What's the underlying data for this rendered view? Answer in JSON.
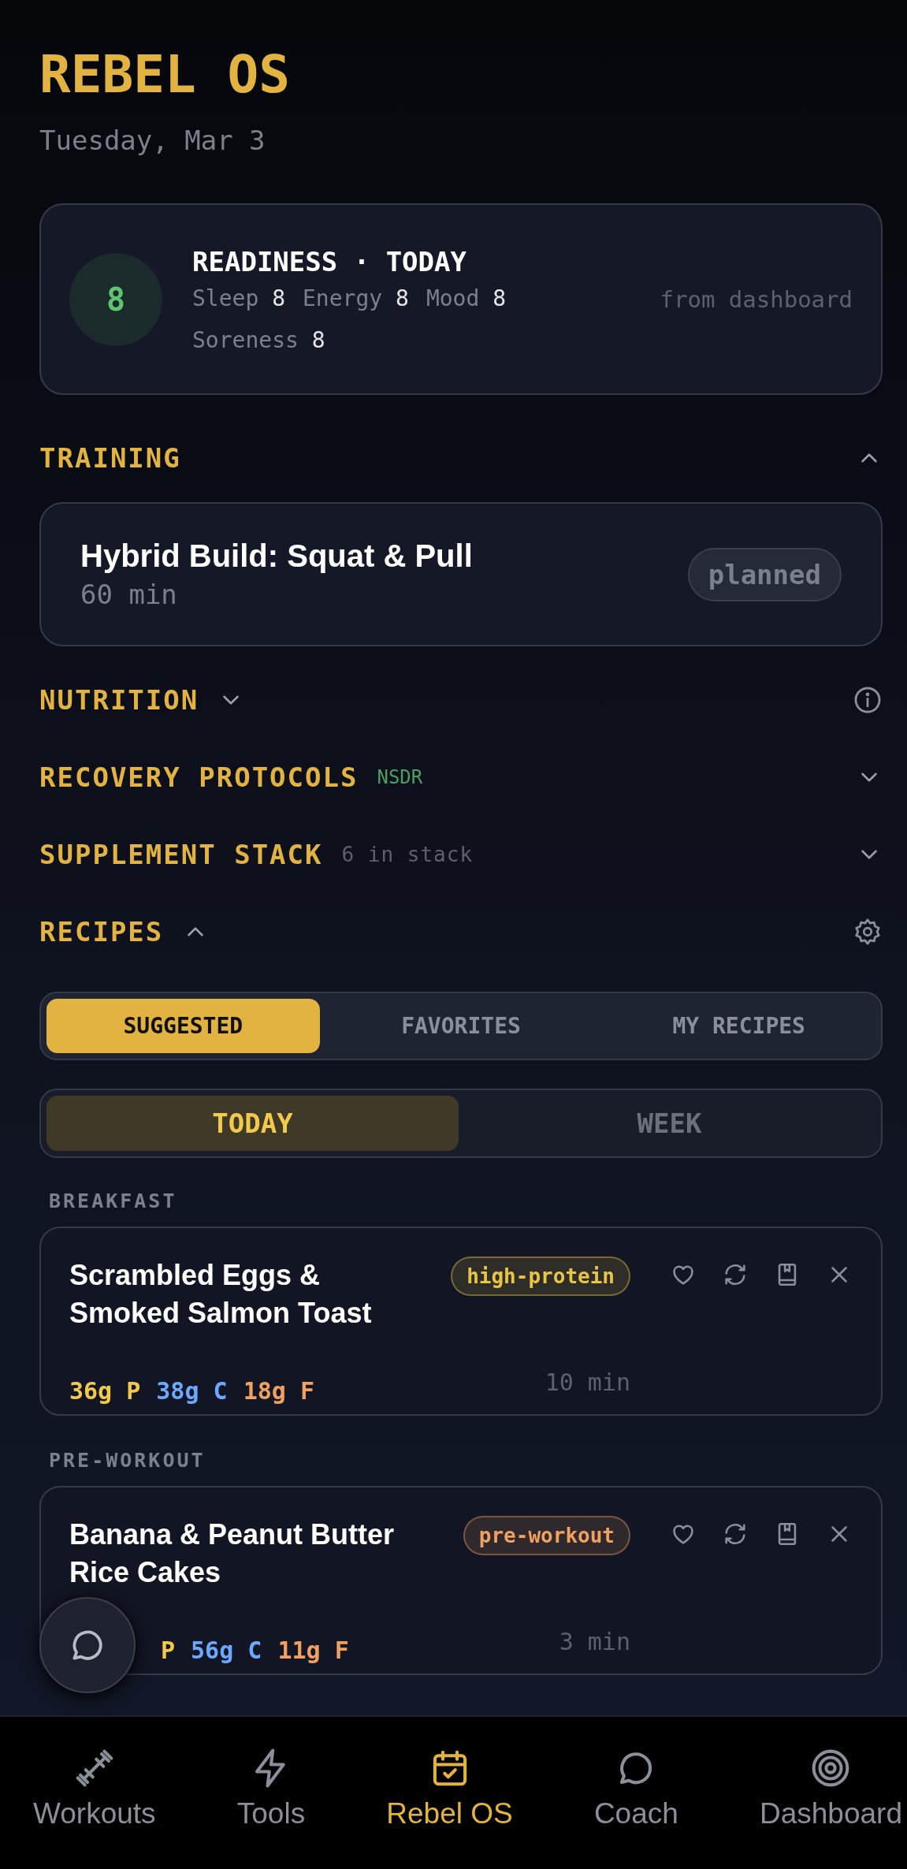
{
  "app_title": "REBEL OS",
  "date": "Tuesday, Mar 3",
  "readiness": {
    "score": "8",
    "title": "READINESS · TODAY",
    "metrics": [
      {
        "label": "Sleep",
        "value": "8"
      },
      {
        "label": "Energy",
        "value": "8"
      },
      {
        "label": "Mood",
        "value": "8"
      },
      {
        "label": "Soreness",
        "value": "8"
      }
    ],
    "source": "from dashboard"
  },
  "sections": [
    {
      "kind": "end-chevron",
      "title": "TRAINING",
      "expanded": true
    },
    {
      "kind": "inline-chevron",
      "title": "NUTRITION",
      "expanded": false,
      "info_button": true
    },
    {
      "kind": "end-chevron",
      "title": "RECOVERY PROTOCOLS",
      "expanded": false,
      "tag": "NSDR"
    },
    {
      "kind": "end-chevron",
      "title": "SUPPLEMENT STACK",
      "expanded": false,
      "note": "6 in stack"
    },
    {
      "kind": "inline-chevron",
      "title": "RECIPES",
      "expanded": true,
      "settings_button": true
    }
  ],
  "training": {
    "workout": "Hybrid Build: Squat & Pull",
    "duration": "60 min",
    "status": "planned"
  },
  "recipe_tabs": [
    {
      "label": "SUGGESTED",
      "selected": true
    },
    {
      "label": "FAVORITES",
      "selected": false
    },
    {
      "label": "MY RECIPES",
      "selected": false
    }
  ],
  "periods": [
    {
      "label": "TODAY",
      "selected": true
    },
    {
      "label": "WEEK",
      "selected": false
    }
  ],
  "meals": [
    {
      "slot": "BREAKFAST",
      "title": "Scrambled Eggs & Smoked Salmon Toast",
      "tag": "high-protein",
      "color": "#e8c547",
      "macros": [
        {
          "kind": "protein",
          "amount": "36g",
          "unit": "P"
        },
        {
          "kind": "carbs",
          "amount": "38g",
          "unit": "C"
        },
        {
          "kind": "fat",
          "amount": "18g",
          "unit": "F"
        }
      ],
      "time": "10 min"
    },
    {
      "slot": "PRE-WORKOUT",
      "title": "Banana & Peanut Butter Rice Cakes",
      "tag": "pre-workout",
      "color": "#f0a060",
      "macros": [
        {
          "kind": "protein",
          "unit": "P"
        },
        {
          "kind": "carbs",
          "amount": "56g",
          "unit": "C"
        },
        {
          "kind": "fat",
          "amount": "11g",
          "unit": "F"
        }
      ],
      "time": "3 min"
    }
  ],
  "nav": [
    {
      "label": "Workouts",
      "selected": false
    },
    {
      "label": "Tools",
      "selected": false
    },
    {
      "label": "Rebel OS",
      "selected": true
    },
    {
      "label": "Coach",
      "selected": false
    },
    {
      "label": "Dashboard",
      "selected": false
    }
  ]
}
